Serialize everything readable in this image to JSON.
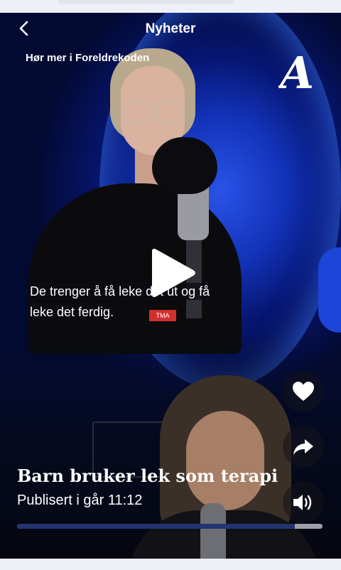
{
  "header": {
    "title": "Nyheter",
    "promo": "Hør mer i Foreldrekoden",
    "back_icon": "chevron-left-icon",
    "logo": "A"
  },
  "video": {
    "subtitle_line1": "De trenger å få leke det ut og få",
    "subtitle_line2": "leke det ferdig.",
    "mic_sticker": "TMA",
    "title": "Barn bruker lek som terapi",
    "published": "Publisert i går 11:12",
    "progress": 0.91
  },
  "actions": [
    "heart-icon",
    "share-icon",
    "volume-icon"
  ],
  "colors": {
    "accent_blue": "#1233b9",
    "progress_fill": "#24346e",
    "progress_track": "#9ea0a8"
  }
}
